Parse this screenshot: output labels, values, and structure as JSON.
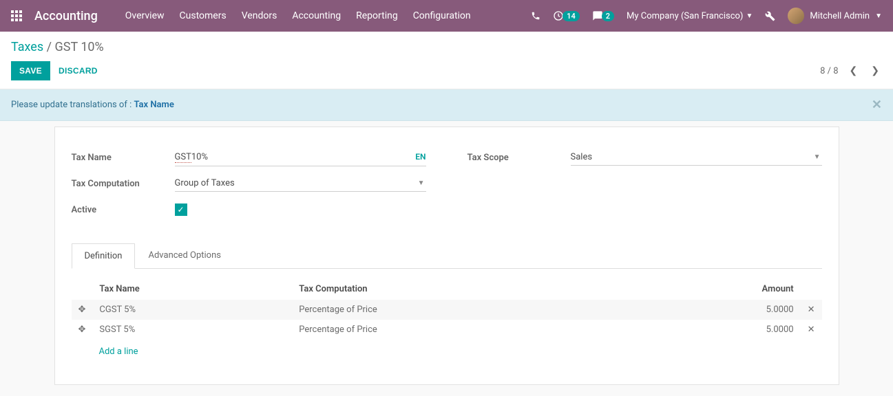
{
  "navbar": {
    "app_title": "Accounting",
    "menu": [
      "Overview",
      "Customers",
      "Vendors",
      "Accounting",
      "Reporting",
      "Configuration"
    ],
    "clock_badge": "14",
    "chat_badge": "2",
    "company": "My Company (San Francisco)",
    "user": "Mitchell Admin"
  },
  "breadcrumb": {
    "parent": "Taxes",
    "current": "GST 10%"
  },
  "buttons": {
    "save": "SAVE",
    "discard": "DISCARD"
  },
  "pager": {
    "text": "8 / 8"
  },
  "alert": {
    "prefix": "Please update translations of : ",
    "link": "Tax Name"
  },
  "form": {
    "labels": {
      "tax_name": "Tax Name",
      "tax_computation": "Tax Computation",
      "active": "Active",
      "tax_scope": "Tax Scope"
    },
    "tax_name_value": "GST 10%",
    "tax_name_prefix": "GST",
    "tax_name_suffix": " 10%",
    "lang": "EN",
    "tax_computation_value": "Group of Taxes",
    "tax_scope_value": "Sales",
    "active_checked": true
  },
  "tabs": {
    "definition": "Definition",
    "advanced": "Advanced Options"
  },
  "table": {
    "headers": {
      "tax_name": "Tax Name",
      "tax_computation": "Tax Computation",
      "amount": "Amount"
    },
    "rows": [
      {
        "name": "CGST 5%",
        "computation": "Percentage of Price",
        "amount": "5.0000"
      },
      {
        "name": "SGST 5%",
        "computation": "Percentage of Price",
        "amount": "5.0000"
      }
    ],
    "add_line": "Add a line"
  }
}
